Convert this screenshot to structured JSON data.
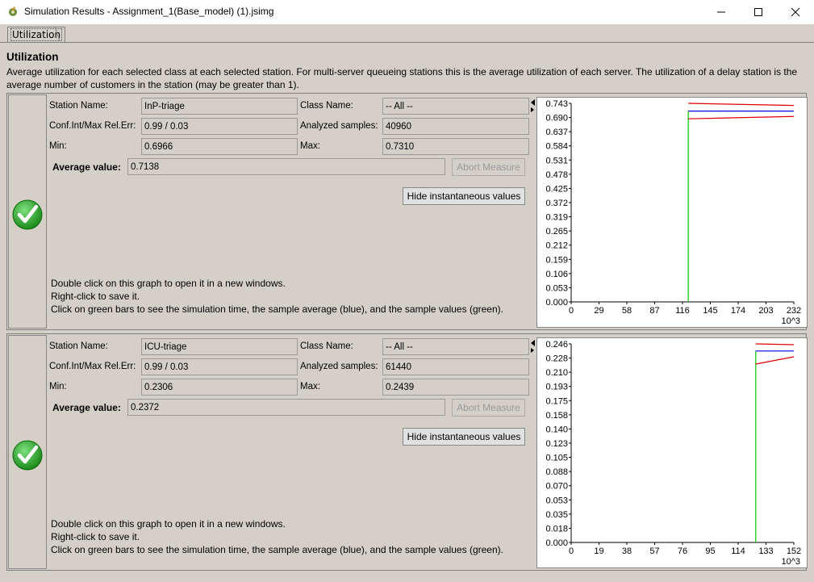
{
  "window": {
    "title": "Simulation Results - Assignment_1(Base_model) (1).jsimg",
    "minimize_icon": "minimize-icon",
    "maximize_icon": "maximize-icon",
    "close_icon": "close-icon"
  },
  "tabs": [
    {
      "label": "Utilization"
    }
  ],
  "content": {
    "heading": "Utilization",
    "description": "Average utilization for each selected class at each selected station. For multi-server queueing stations this is the average utilization of each server. The utilization of a delay station is the average number of customers in the station (may be greater than 1)."
  },
  "labels": {
    "station_name": "Station Name:",
    "class_name": "Class Name:",
    "conf_int": "Conf.Int/Max Rel.Err:",
    "analyzed_samples": "Analyzed samples:",
    "min": "Min:",
    "max": "Max:",
    "average": "Average value:",
    "abort": "Abort Measure",
    "hide": "Hide instantaneous values",
    "hint1": "Double click on this graph to open it in a new windows.",
    "hint2": "Right-click to save it.",
    "hint3": "Click on green bars to see the simulation time, the sample average (blue), and the sample values (green)."
  },
  "measures": [
    {
      "station": "InP-triage",
      "class": "-- All --",
      "conf": "0.99 / 0.03",
      "samples": "40960",
      "min": "0.6966",
      "max": "0.7310",
      "average": "0.7138",
      "status_icon": "checkmark-icon",
      "chart": {
        "y_ticks": [
          "0.743",
          "0.690",
          "0.637",
          "0.584",
          "0.531",
          "0.478",
          "0.425",
          "0.372",
          "0.319",
          "0.265",
          "0.212",
          "0.159",
          "0.106",
          "0.053",
          "0.000"
        ],
        "x_ticks": [
          "0",
          "29",
          "58",
          "87",
          "116",
          "145",
          "174",
          "203",
          "232"
        ],
        "x_unit": "10^3",
        "ymax": 0.743,
        "xmax": 232,
        "green_x": 122,
        "green_top": 0.7138,
        "series": {
          "upper": [
            [
              122,
              0.743
            ],
            [
              232,
              0.735
            ]
          ],
          "mean": [
            [
              122,
              0.714
            ],
            [
              232,
              0.714
            ]
          ],
          "lower": [
            [
              122,
              0.685
            ],
            [
              232,
              0.694
            ]
          ]
        },
        "colors": {
          "upper": "#e00000",
          "mean": "#0000e0",
          "lower": "#e00000",
          "sample": "#00c800"
        }
      }
    },
    {
      "station": "ICU-triage",
      "class": "-- All --",
      "conf": "0.99 / 0.03",
      "samples": "61440",
      "min": "0.2306",
      "max": "0.2439",
      "average": "0.2372",
      "status_icon": "checkmark-icon",
      "chart": {
        "y_ticks": [
          "0.246",
          "0.228",
          "0.210",
          "0.193",
          "0.175",
          "0.158",
          "0.140",
          "0.123",
          "0.105",
          "0.088",
          "0.070",
          "0.053",
          "0.035",
          "0.018",
          "0.000"
        ],
        "x_ticks": [
          "0",
          "19",
          "38",
          "57",
          "76",
          "95",
          "114",
          "133",
          "152"
        ],
        "x_unit": "10^3",
        "ymax": 0.246,
        "xmax": 152,
        "green_x": 126,
        "green_top": 0.2372,
        "series": {
          "upper": [
            [
              126,
              0.246
            ],
            [
              152,
              0.245
            ]
          ],
          "mean": [
            [
              126,
              0.2372
            ],
            [
              152,
              0.2372
            ]
          ],
          "lower": [
            [
              126,
              0.221
            ],
            [
              152,
              0.23
            ]
          ]
        },
        "colors": {
          "upper": "#e00000",
          "mean": "#0000e0",
          "lower": "#e00000",
          "sample": "#00c800"
        }
      }
    }
  ]
}
